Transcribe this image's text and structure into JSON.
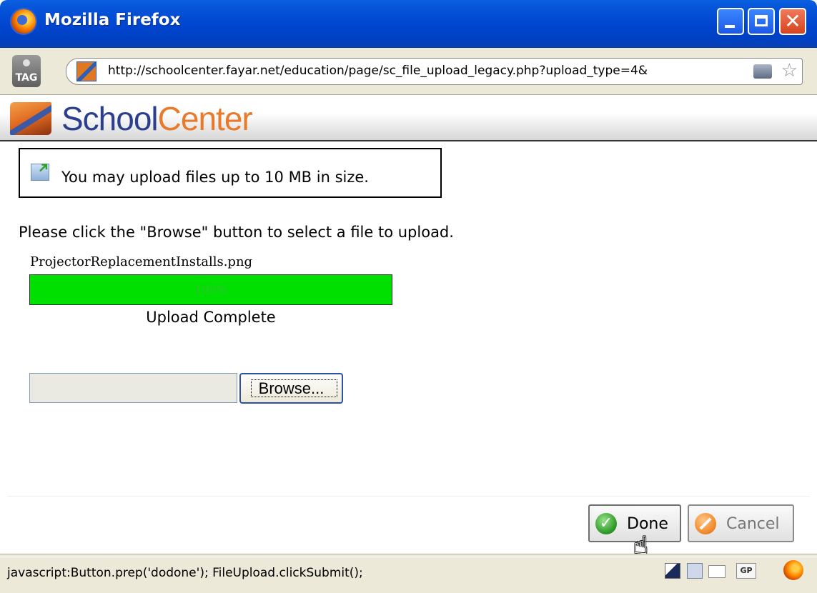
{
  "window": {
    "title": "Mozilla Firefox"
  },
  "addressbar": {
    "url": "http://schoolcenter.fayar.net/education/page/sc_file_upload_legacy.php?upload_type=4&",
    "tag_label": "TAG"
  },
  "brand": {
    "name_part1": "School",
    "name_part2": "Center"
  },
  "upload": {
    "info_text": "You may upload files up to 10 MB in size.",
    "instruction": "Please click the \"Browse\" button to select a file to upload.",
    "filename": "ProjectorReplacementInstalls.png",
    "progress_percent": 100,
    "progress_label": "100%",
    "status": "Upload Complete",
    "file_input_value": "",
    "browse_label": "Browse..."
  },
  "footer": {
    "done_label": "Done",
    "cancel_label": "Cancel"
  },
  "statusbar": {
    "text": "javascript:Button.prep('dodone'); FileUpload.clickSubmit();",
    "gp_label": "GP"
  },
  "icons": {
    "browser": "firefox-icon",
    "tag": "tag-icon",
    "favicon": "schoolcenter-favicon",
    "rss": "rss-icon",
    "bookmark": "bookmark-star-icon",
    "upload": "upload-icon",
    "done": "checkmark-icon",
    "cancel": "cancel-icon",
    "cursor": "hand-cursor-icon"
  },
  "colors": {
    "titlebar": "#0045cf",
    "progress_fill": "#00e000",
    "brand_blue": "#2b3f8c",
    "brand_orange": "#e97a2c"
  }
}
